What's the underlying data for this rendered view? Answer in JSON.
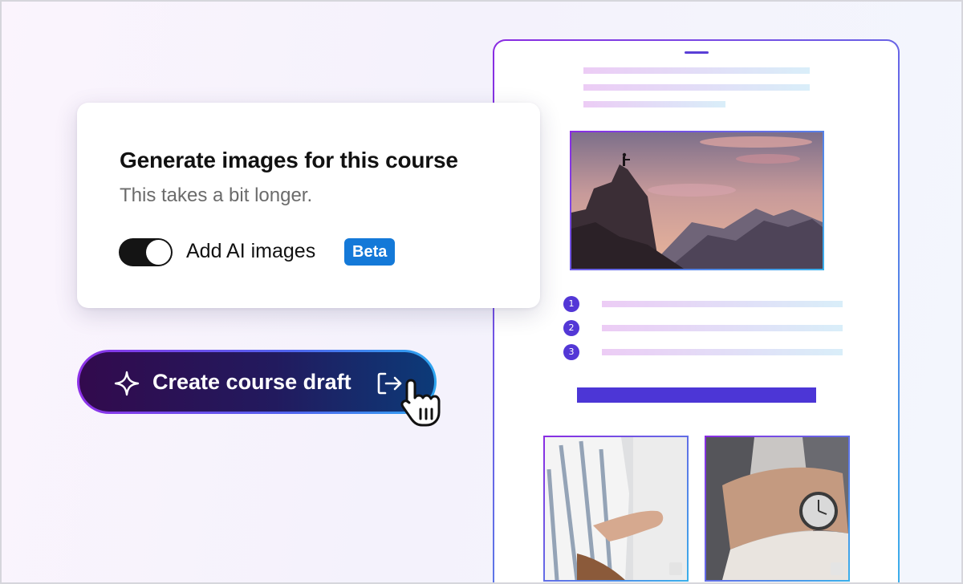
{
  "card": {
    "title": "Generate images for this course",
    "subtitle": "This takes a bit longer.",
    "toggle": {
      "label": "Add AI images",
      "on": true
    },
    "badge": "Beta"
  },
  "create_button": {
    "label": "Create course draft"
  },
  "preview": {
    "steps": [
      "1",
      "2",
      "3"
    ]
  },
  "colors": {
    "accent": "#4c36d6",
    "badge": "#1479d8",
    "toggle_on": "#141414"
  },
  "icons": [
    "sparkle-icon",
    "exit-arrow-icon",
    "hand-pointer-icon"
  ]
}
